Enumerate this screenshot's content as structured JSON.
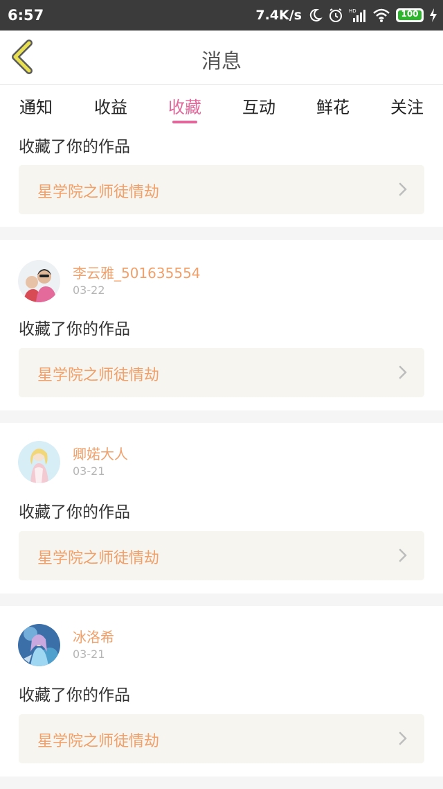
{
  "status_bar": {
    "time": "6:57",
    "net_speed": "7.4K/s",
    "battery": "100",
    "icons": [
      "moon-icon",
      "alarm-icon",
      "hd-signal-icon",
      "wifi-icon",
      "battery-icon",
      "charging-icon"
    ]
  },
  "header": {
    "title": "消息",
    "back_icon": "chevron-left-icon"
  },
  "tabs": [
    {
      "label": "通知",
      "active": false
    },
    {
      "label": "收益",
      "active": false
    },
    {
      "label": "收藏",
      "active": true
    },
    {
      "label": "互动",
      "active": false
    },
    {
      "label": "鲜花",
      "active": false
    },
    {
      "label": "关注",
      "active": false
    }
  ],
  "colors": {
    "accent": "#e0679a",
    "username": "#f0a06a",
    "status_bar": "#3b3b3b",
    "link_bg": "#f6f5ef"
  },
  "feed": {
    "partial_item": {
      "action": "收藏了你的作品",
      "work_title": "星学院之师徒情劫"
    },
    "items": [
      {
        "username": "李云雅_501635554",
        "date": "03-22",
        "action": "收藏了你的作品",
        "work_title": "星学院之师徒情劫"
      },
      {
        "username": "卿婼大人",
        "date": "03-21",
        "action": "收藏了你的作品",
        "work_title": "星学院之师徒情劫"
      },
      {
        "username": "冰洛希",
        "date": "03-21",
        "action": "收藏了你的作品",
        "work_title": "星学院之师徒情劫"
      }
    ]
  }
}
